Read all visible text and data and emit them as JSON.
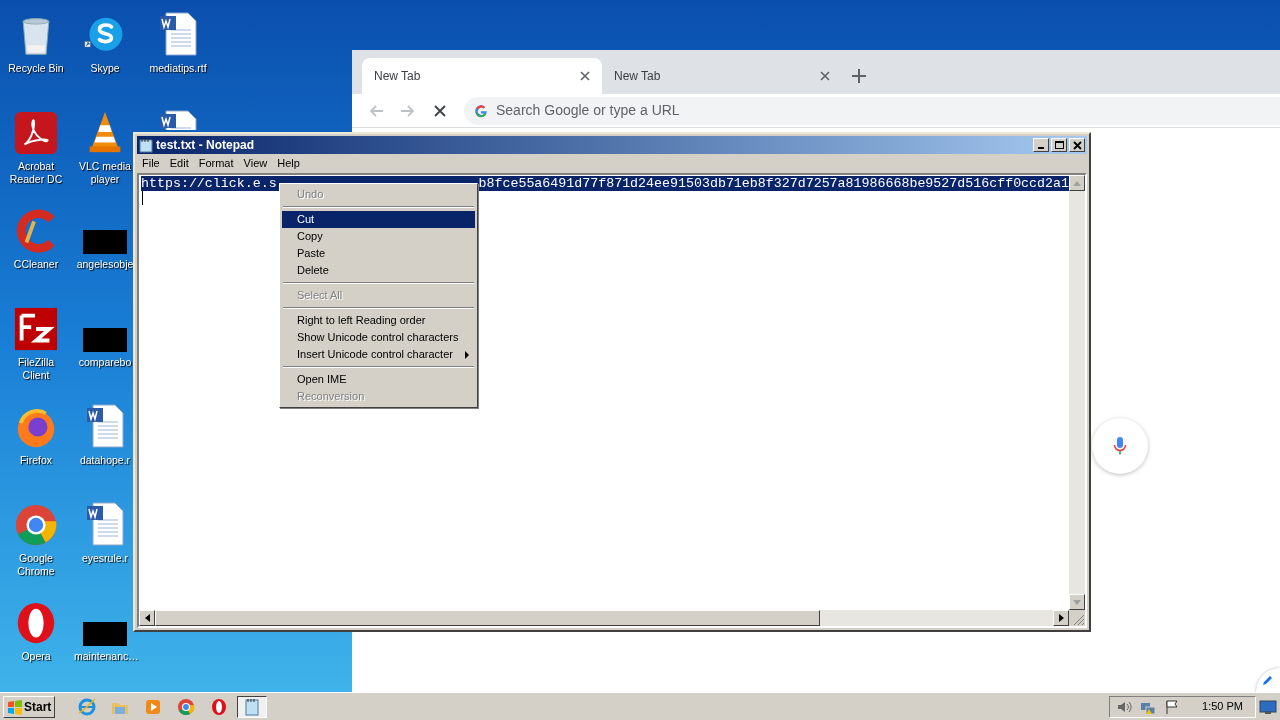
{
  "desktop_icons": [
    {
      "kind": "recycle",
      "label": "Recycle Bin"
    },
    {
      "kind": "acrobat",
      "label": "Acrobat Reader DC"
    },
    {
      "kind": "ccleaner",
      "label": "CCleaner"
    },
    {
      "kind": "filezilla",
      "label": "FileZilla Client"
    },
    {
      "kind": "firefox",
      "label": "Firefox"
    },
    {
      "kind": "chrome",
      "label": "Google Chrome"
    },
    {
      "kind": "opera",
      "label": "Opera"
    },
    {
      "kind": "skype",
      "label": "Skype"
    },
    {
      "kind": "vlc",
      "label": "VLC media player"
    },
    {
      "kind": "redacted",
      "label": "angelesobje"
    },
    {
      "kind": "redacted",
      "label": "comparebo"
    },
    {
      "kind": "word",
      "label": "datahope.r"
    },
    {
      "kind": "word",
      "label": "eyesrule.r"
    },
    {
      "kind": "redacted",
      "label": "maintenanc…"
    },
    {
      "kind": "word",
      "label": "mediatips.rtf"
    },
    {
      "kind": "word"
    }
  ],
  "browser": {
    "tabs": [
      {
        "title": "New Tab",
        "selected": true
      },
      {
        "title": "New Tab",
        "selected": false
      }
    ],
    "address_placeholder": "Search Google or type a URL"
  },
  "notepad": {
    "title": "test.txt - Notepad",
    "menu": [
      "File",
      "Edit",
      "Format",
      "View",
      "Help"
    ],
    "text_left": "https://click.e.s",
    "text_right": "b8fce55a6491d77f871d24ee91503db71eb8f327d7257a81986668be9527d516cff0ccd2a1",
    "context_menu": [
      {
        "kind": "item",
        "label": "Undo",
        "disabled": true,
        "selected": false,
        "submenu": false
      },
      {
        "kind": "separator"
      },
      {
        "kind": "item",
        "label": "Cut",
        "disabled": false,
        "selected": true,
        "submenu": false
      },
      {
        "kind": "item",
        "label": "Copy",
        "disabled": false,
        "selected": false,
        "submenu": false
      },
      {
        "kind": "item",
        "label": "Paste",
        "disabled": false,
        "selected": false,
        "submenu": false
      },
      {
        "kind": "item",
        "label": "Delete",
        "disabled": false,
        "selected": false,
        "submenu": false
      },
      {
        "kind": "separator"
      },
      {
        "kind": "item",
        "label": "Select All",
        "disabled": true,
        "selected": false,
        "submenu": false
      },
      {
        "kind": "separator"
      },
      {
        "kind": "item",
        "label": "Right to left Reading order",
        "disabled": false,
        "selected": false,
        "submenu": false
      },
      {
        "kind": "item",
        "label": "Show Unicode control characters",
        "disabled": false,
        "selected": false,
        "submenu": false
      },
      {
        "kind": "item",
        "label": "Insert Unicode control character",
        "disabled": false,
        "selected": false,
        "submenu": true
      },
      {
        "kind": "separator"
      },
      {
        "kind": "item",
        "label": "Open IME",
        "disabled": false,
        "selected": false,
        "submenu": false
      },
      {
        "kind": "item",
        "label": "Reconversion",
        "disabled": true,
        "selected": false,
        "submenu": false
      }
    ]
  },
  "taskbar": {
    "start": "Start",
    "apps": [
      {
        "kind": "ie",
        "selected": false
      },
      {
        "kind": "explorer",
        "selected": false
      },
      {
        "kind": "media",
        "selected": false
      },
      {
        "kind": "chrome",
        "selected": false
      },
      {
        "kind": "opera",
        "selected": false
      },
      {
        "kind": "notepad",
        "selected": true
      }
    ],
    "clock": "1:50 PM"
  }
}
